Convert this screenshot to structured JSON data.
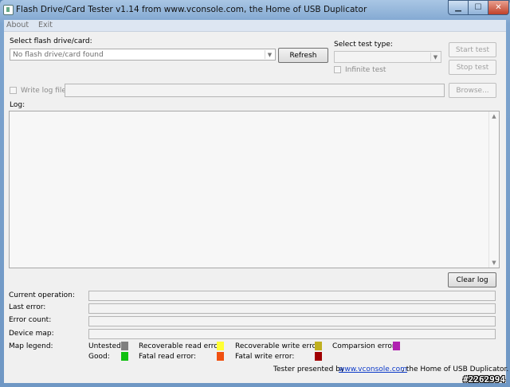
{
  "window": {
    "title": "Flash Drive/Card Tester v1.14 from www.vconsole.com, the Home of USB Duplicator"
  },
  "menu": [
    "About",
    "Exit"
  ],
  "drive": {
    "label": "Select flash drive/card:",
    "value": "No flash drive/card found",
    "refresh_label": "Refresh"
  },
  "test_type": {
    "label": "Select test type:",
    "value": "",
    "infinite_label": "Infinite test"
  },
  "buttons": {
    "start": "Start test",
    "stop": "Stop test",
    "browse": "Browse...",
    "clear_log": "Clear log"
  },
  "write_log": {
    "label": "Write log file",
    "path": ""
  },
  "log": {
    "label": "Log:",
    "content": ""
  },
  "status": {
    "current_operation": "Current operation:",
    "last_error": "Last error:",
    "error_count": "Error count:",
    "device_map": "Device map:"
  },
  "legend": {
    "label": "Map legend:",
    "items": [
      {
        "label": "Untested:",
        "color": "#808080"
      },
      {
        "label": "Recoverable read error:",
        "color": "#ffff33"
      },
      {
        "label": "Recoverable write error:",
        "color": "#c0b020"
      },
      {
        "label": "Comparsion error:",
        "color": "#b020b0"
      },
      {
        "label": "Good:",
        "color": "#10c010"
      },
      {
        "label": "Fatal read error:",
        "color": "#f05010"
      },
      {
        "label": "Fatal write error:",
        "color": "#a00000"
      }
    ]
  },
  "footer": {
    "prefix": "Tester presented by",
    "link": "www.vconsole.com",
    "suffix": ", the Home of USB Duplicator."
  },
  "watermark": "#2262994"
}
